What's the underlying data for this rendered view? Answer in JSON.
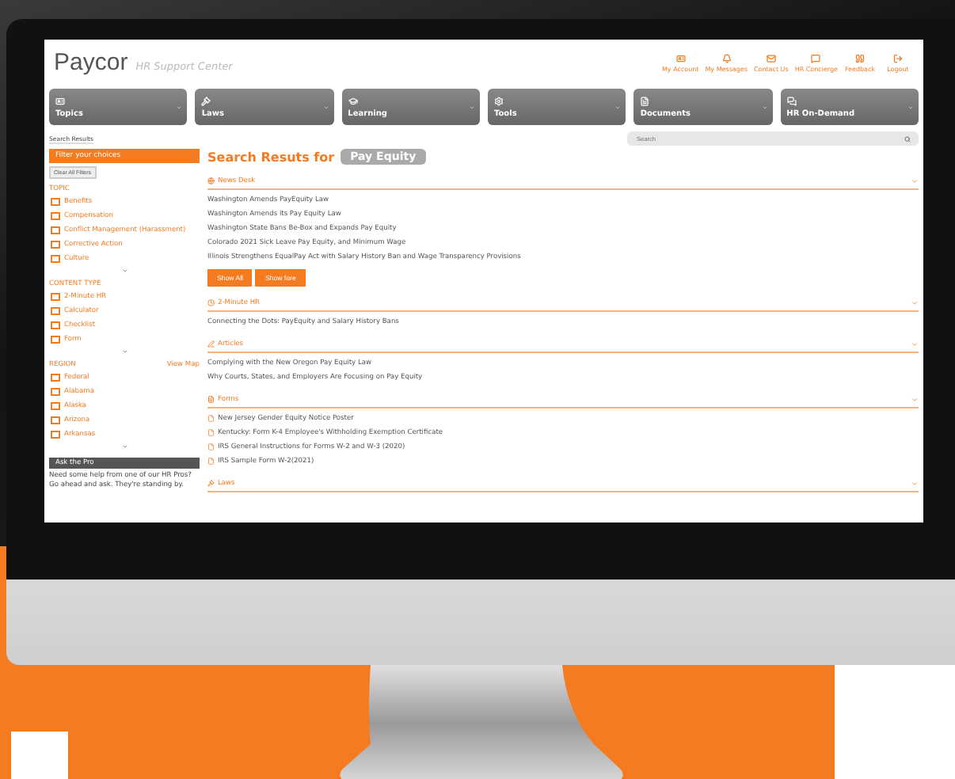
{
  "header": {
    "logo": "Paycor",
    "subtitle": "HR Support Center",
    "links": [
      {
        "kind": "account",
        "label": "My Account"
      },
      {
        "kind": "bell",
        "label": "My Messages"
      },
      {
        "kind": "mail",
        "label": "Contact Us"
      },
      {
        "kind": "chat",
        "label": "HR Concierge"
      },
      {
        "kind": "quote",
        "label": "Feedback"
      },
      {
        "kind": "logout",
        "label": "Logout"
      }
    ]
  },
  "nav": [
    {
      "kind": "card",
      "label": "Topics"
    },
    {
      "kind": "gavel",
      "label": "Laws"
    },
    {
      "kind": "cap",
      "label": "Learning"
    },
    {
      "kind": "gear",
      "label": "Tools"
    },
    {
      "kind": "file",
      "label": "Documents"
    },
    {
      "kind": "chat",
      "label": "HR On-Demand"
    }
  ],
  "breadcrumb": "Search Results",
  "search": {
    "placeholder": "Search"
  },
  "sidebar": {
    "filter_title": "Filter your choices",
    "clear_button": "Clear All Filters",
    "groups": [
      {
        "title": "TOPIC",
        "items": [
          {
            "label": "Benefits",
            "checked": false
          },
          {
            "label": "Compensation",
            "checked": false
          },
          {
            "label": "Conflict Management (Harassment)",
            "checked": false
          },
          {
            "label": "Corrective Action",
            "checked": false
          },
          {
            "label": "Culture",
            "checked": false
          }
        ]
      },
      {
        "title": "CONTENT TYPE",
        "items": [
          {
            "label": "2-Minute HR",
            "checked": false
          },
          {
            "label": "Calculator",
            "checked": false
          },
          {
            "label": "Checklist",
            "checked": false
          },
          {
            "label": "Form",
            "checked": false
          }
        ]
      },
      {
        "title": "REGION",
        "action": "View Map",
        "items": [
          {
            "label": "Federal",
            "checked": false
          },
          {
            "label": "Alabama",
            "checked": false
          },
          {
            "label": "Alaska",
            "checked": false
          },
          {
            "label": "Arizona",
            "checked": false
          },
          {
            "label": "Arkansas",
            "checked": false
          }
        ]
      }
    ],
    "ask": {
      "title": "Ask the Pro",
      "text": "Need some help from one of our HR Pros? Go ahead and ask. They're standing by."
    }
  },
  "main": {
    "heading": "Search Resuts for",
    "query": "Pay Equity",
    "sections": [
      {
        "kind": "globe",
        "title": "News Desk",
        "items": [
          "Washington Amends PayEquity Law",
          "Washington Amends its Pay Equity Law",
          "Washington State Bans Be-Box and Expands Pay Equity",
          "Colorado 2021 Sick Leave Pay Equity, and Minimum Wage",
          "Illinois Strengthens EqualPay Act with Salary History Ban and Wage Transparency Provisions"
        ],
        "buttons": [
          "Show All",
          "Show fore"
        ]
      },
      {
        "kind": "clock",
        "title": "2-Minute HR",
        "items": [
          "Connecting the Dots: PayEquity and Salary History Bans"
        ]
      },
      {
        "kind": "pen",
        "title": "Articles",
        "items": [
          "Complying with the New Oregon Pay Equity Law",
          "Why Courts, States, and Employers Are Focusing on Pay Equity"
        ]
      },
      {
        "kind": "file",
        "title": "Forms",
        "doc_items": [
          "New Jersey Gender Equity Notice Poster",
          "Kentucky: Form K-4 Employee's Withholding Exemption Certificate",
          "IRS General Instructions for Forms W-2 and W-3 (2020)",
          "IRS Sample Form W-2(2021)"
        ]
      },
      {
        "kind": "gavel",
        "title": "Laws"
      }
    ]
  }
}
